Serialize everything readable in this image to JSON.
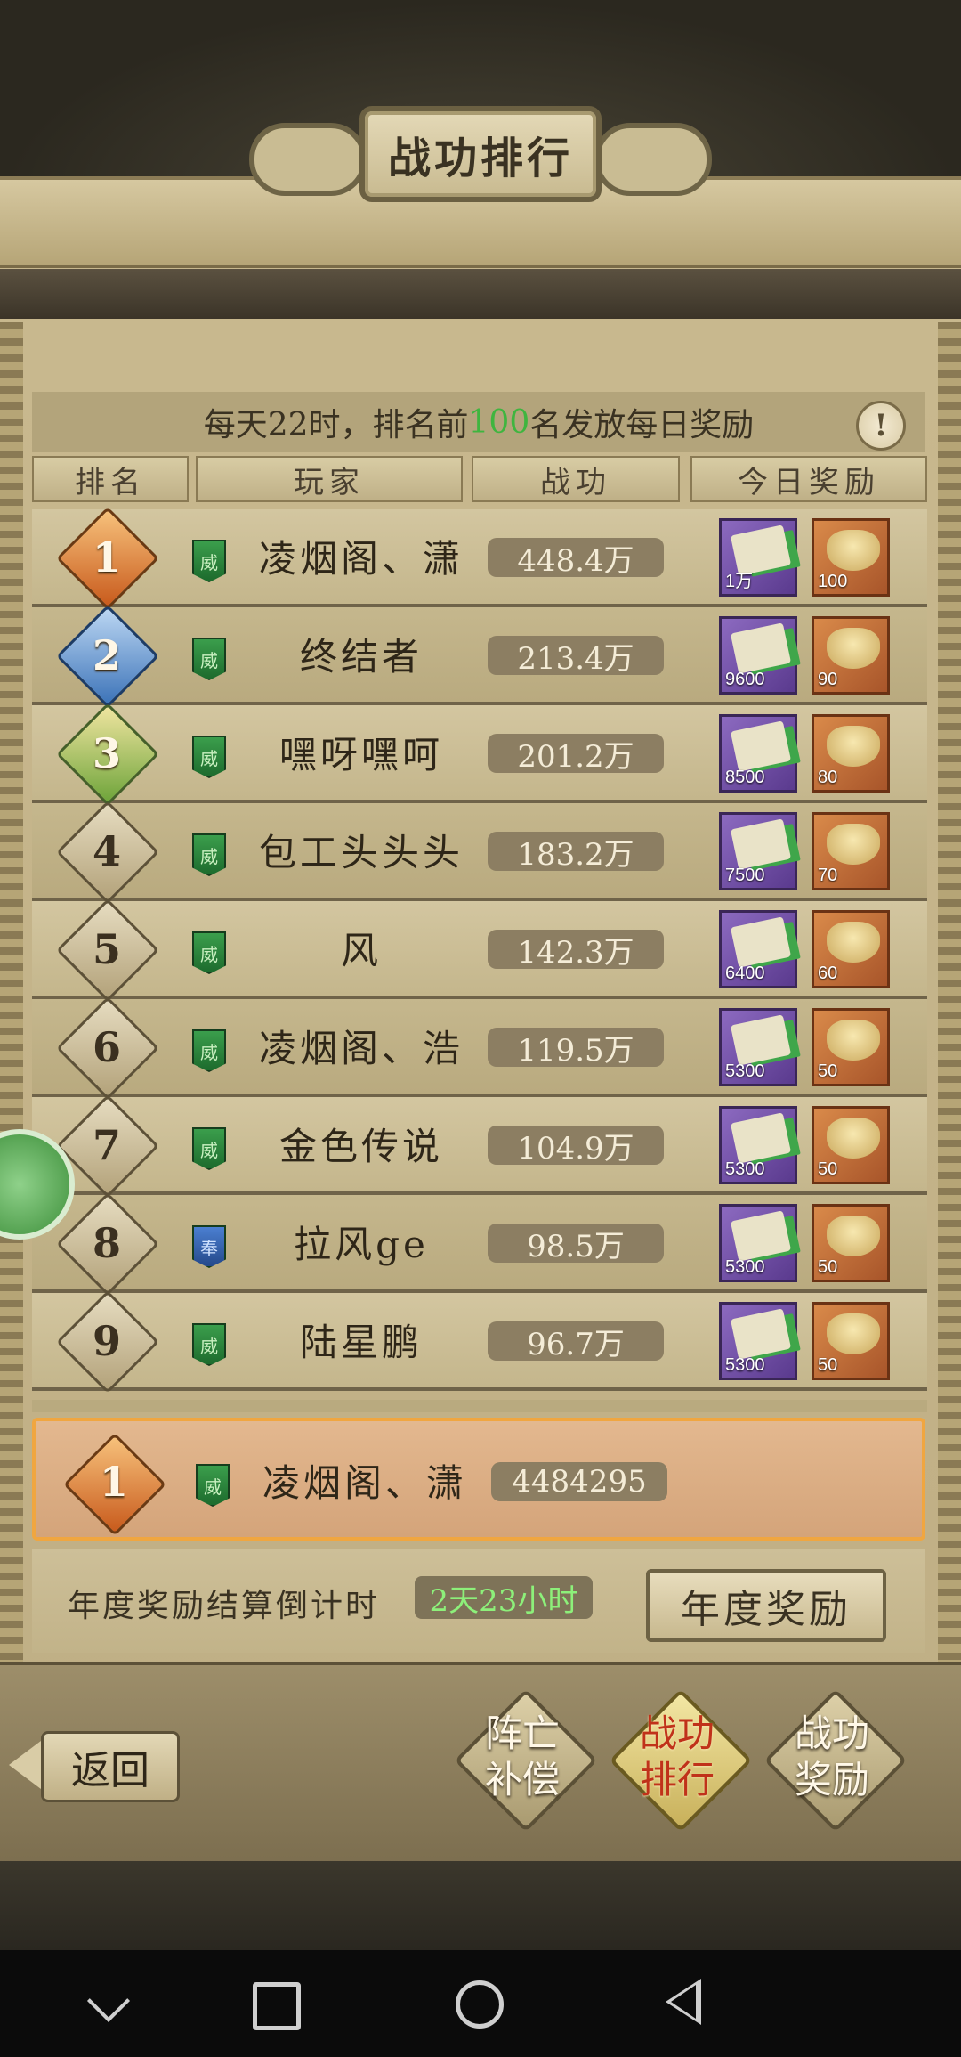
{
  "title": "战功排行",
  "notice": {
    "prefix": "每天22时，排名前",
    "highlight": "100",
    "suffix": "名发放每日奖励",
    "info_icon": "!"
  },
  "headers": [
    "排名",
    "玩家",
    "战功",
    "今日奖励"
  ],
  "rows": [
    {
      "rank": "1",
      "badge": "威",
      "badge_color": "green",
      "name": "凌烟阁、潇",
      "power": "448.4万",
      "reward_book": "1万",
      "reward_ingot": "100"
    },
    {
      "rank": "2",
      "badge": "威",
      "badge_color": "green",
      "name": "终结者",
      "power": "213.4万",
      "reward_book": "9600",
      "reward_ingot": "90"
    },
    {
      "rank": "3",
      "badge": "威",
      "badge_color": "green",
      "name": "嘿呀嘿呵",
      "power": "201.2万",
      "reward_book": "8500",
      "reward_ingot": "80"
    },
    {
      "rank": "4",
      "badge": "威",
      "badge_color": "green",
      "name": "包工头头头",
      "power": "183.2万",
      "reward_book": "7500",
      "reward_ingot": "70"
    },
    {
      "rank": "5",
      "badge": "威",
      "badge_color": "green",
      "name": "风",
      "power": "142.3万",
      "reward_book": "6400",
      "reward_ingot": "60"
    },
    {
      "rank": "6",
      "badge": "威",
      "badge_color": "green",
      "name": "凌烟阁、浩",
      "power": "119.5万",
      "reward_book": "5300",
      "reward_ingot": "50"
    },
    {
      "rank": "7",
      "badge": "威",
      "badge_color": "green",
      "name": "金色传说",
      "power": "104.9万",
      "reward_book": "5300",
      "reward_ingot": "50"
    },
    {
      "rank": "8",
      "badge": "奉",
      "badge_color": "blue",
      "name": "拉风ge",
      "power": "98.5万",
      "reward_book": "5300",
      "reward_ingot": "50"
    },
    {
      "rank": "9",
      "badge": "威",
      "badge_color": "green",
      "name": "陆星鹏",
      "power": "96.7万",
      "reward_book": "5300",
      "reward_ingot": "50"
    }
  ],
  "self": {
    "rank": "1",
    "badge": "威",
    "name": "凌烟阁、潇",
    "power": "4484295"
  },
  "annual": {
    "label": "年度奖励结算倒计时",
    "countdown": "2天23小时",
    "button": "年度奖励"
  },
  "back": "返回",
  "tabs": [
    {
      "line1": "阵亡",
      "line2": "补偿",
      "active": false
    },
    {
      "line1": "战功",
      "line2": "排行",
      "active": true
    },
    {
      "line1": "战功",
      "line2": "奖励",
      "active": false
    }
  ],
  "colors": {
    "highlight_green": "#3fb53f",
    "self_border": "#f0a640",
    "active_tab_text": "#c0321a"
  }
}
